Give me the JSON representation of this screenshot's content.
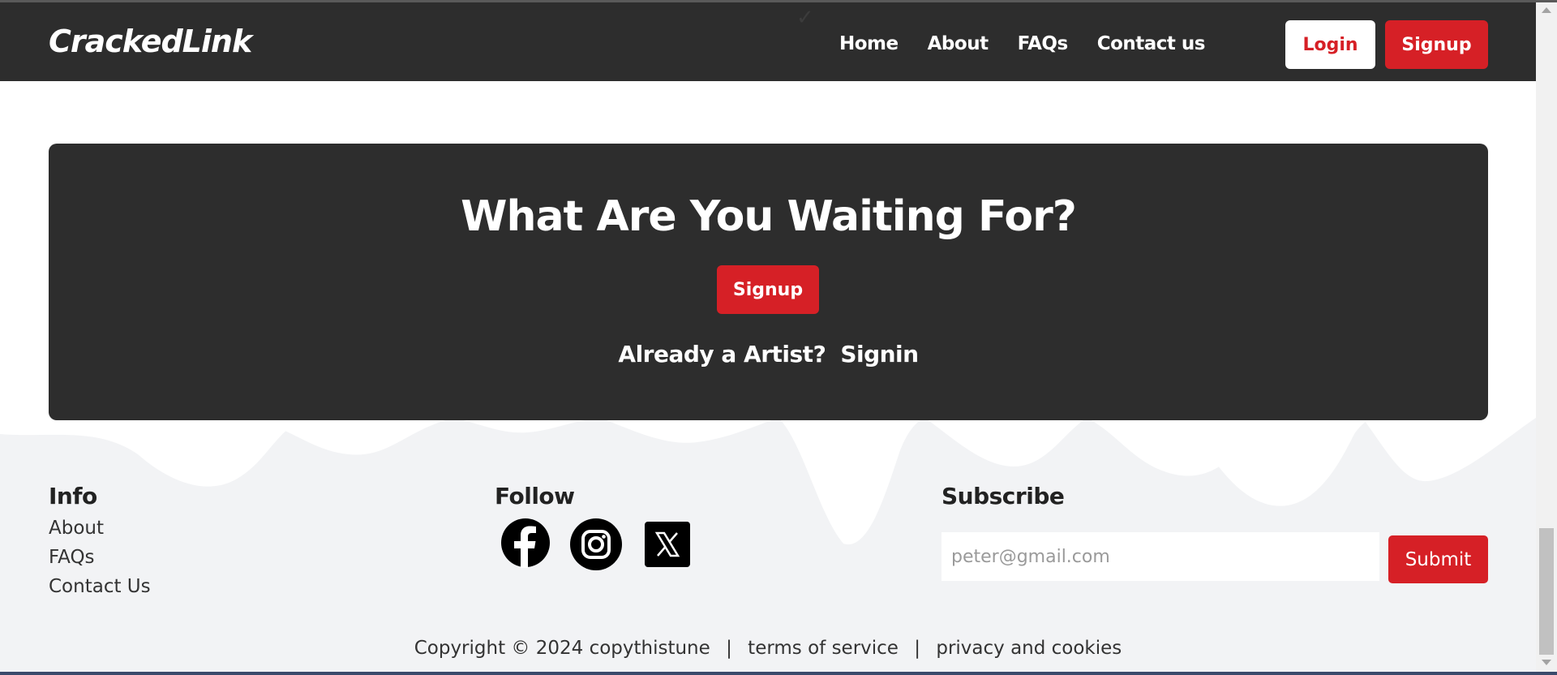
{
  "navbar": {
    "logo": "CrackedLink",
    "links": [
      "Home",
      "About",
      "FAQs",
      "Contact us"
    ],
    "login_label": "Login",
    "signup_label": "Signup"
  },
  "cta": {
    "title": "What Are You Waiting For?",
    "signup_label": "Signup",
    "already_text": "Already a Artist?",
    "signin_label": "Signin"
  },
  "footer": {
    "info": {
      "title": "Info",
      "links": [
        "About",
        "FAQs",
        "Contact Us"
      ]
    },
    "follow": {
      "title": "Follow",
      "icons": [
        "facebook-icon",
        "instagram-icon",
        "x-icon"
      ]
    },
    "subscribe": {
      "title": "Subscribe",
      "placeholder": "peter@gmail.com",
      "submit_label": "Submit"
    },
    "copyright": "Copyright © 2024 copythistune",
    "terms": "terms of service",
    "privacy": "privacy and cookies",
    "separator": "|"
  },
  "colors": {
    "accent": "#d62026",
    "dark": "#2d2d2d",
    "footer_bg": "#f2f3f5"
  }
}
